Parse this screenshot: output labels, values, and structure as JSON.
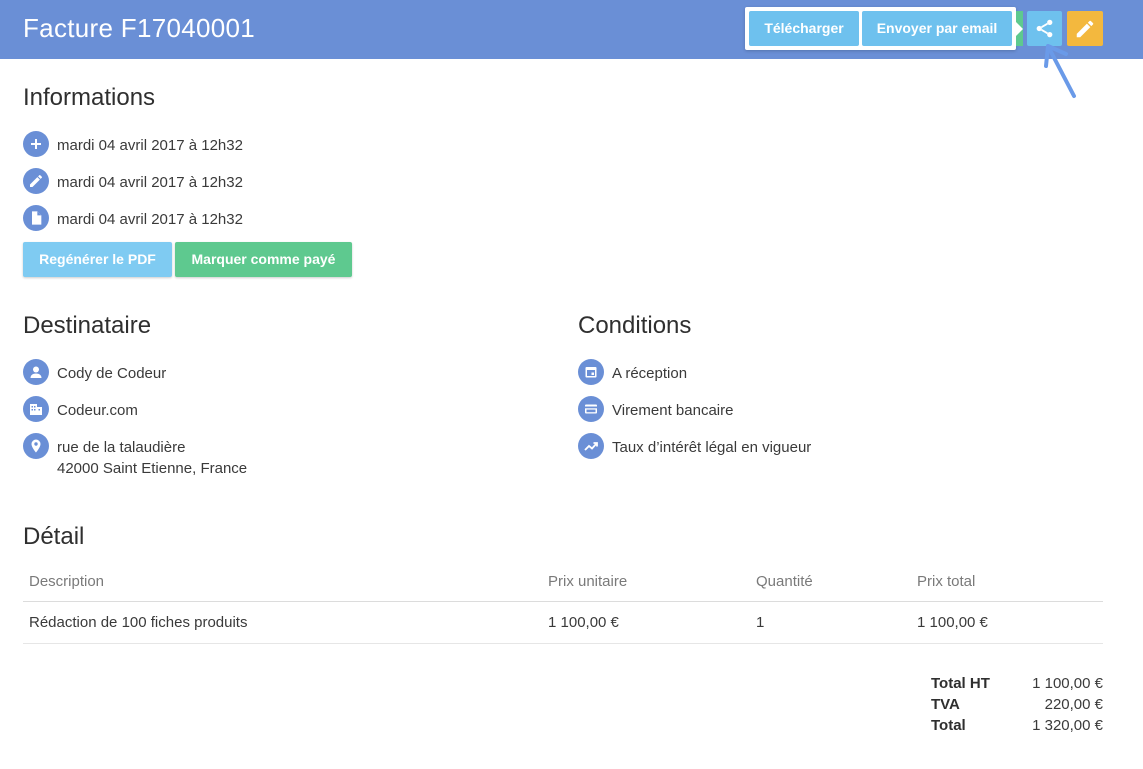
{
  "header": {
    "title": "Facture F17040001",
    "buttons": {
      "download": "Télécharger",
      "email": "Envoyer par email"
    },
    "icons": {
      "share": "share-icon",
      "edit": "pencil-icon"
    }
  },
  "informations": {
    "heading": "Informations",
    "rows": [
      {
        "icon": "plus-icon",
        "text": "mardi 04 avril 2017 à 12h32"
      },
      {
        "icon": "pencil-icon",
        "text": "mardi 04 avril 2017 à 12h32"
      },
      {
        "icon": "document-icon",
        "text": "mardi 04 avril 2017 à 12h32"
      }
    ],
    "buttons": {
      "regenerate": "Regénérer le PDF",
      "mark_paid": "Marquer comme payé"
    }
  },
  "recipient": {
    "heading": "Destinataire",
    "name": "Cody de Codeur",
    "company": "Codeur.com",
    "address_line1": "rue de la talaudière",
    "address_line2": "42000 Saint Etienne, France"
  },
  "conditions": {
    "heading": "Conditions",
    "payment_term": "A réception",
    "payment_method": "Virement bancaire",
    "late_interest": "Taux d’intérêt légal en vigueur"
  },
  "detail": {
    "heading": "Détail",
    "columns": [
      "Description",
      "Prix unitaire",
      "Quantité",
      "Prix total"
    ],
    "rows": [
      [
        "Rédaction de 100 fiches produits",
        "1 100,00 €",
        "1",
        "1 100,00 €"
      ]
    ],
    "totals": [
      {
        "label": "Total HT",
        "value": "1 100,00 €"
      },
      {
        "label": "TVA",
        "value": "220,00 €"
      },
      {
        "label": "Total",
        "value": "1 320,00 €"
      }
    ]
  },
  "colors": {
    "header_bg": "#6a8fd6",
    "light_blue": "#6ec1ee",
    "green": "#5ec98f",
    "orange": "#f3b83e"
  }
}
